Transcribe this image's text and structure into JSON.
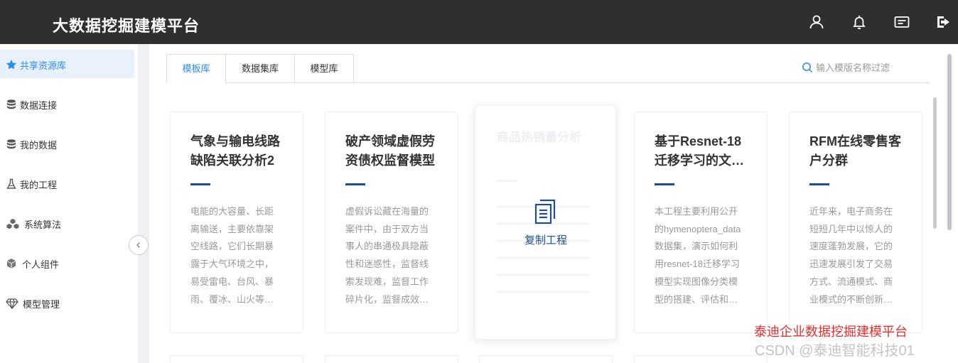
{
  "app": {
    "title": "大数据挖掘建模平台"
  },
  "header_icons": [
    "user-icon",
    "bell-icon",
    "message-icon",
    "logout-icon"
  ],
  "sidebar": {
    "items": [
      {
        "label": "共享资源库",
        "icon": "star-icon",
        "active": true
      },
      {
        "label": "数据连接",
        "icon": "database-icon"
      },
      {
        "label": "我的数据",
        "icon": "database-icon"
      },
      {
        "label": "我的工程",
        "icon": "flask-icon"
      },
      {
        "label": "系统算法",
        "icon": "cubes-icon"
      },
      {
        "label": "个人组件",
        "icon": "cube-icon"
      },
      {
        "label": "模型管理",
        "icon": "diamond-icon"
      }
    ]
  },
  "tabs": [
    {
      "label": "模板库",
      "active": true
    },
    {
      "label": "数据集库"
    },
    {
      "label": "模型库"
    }
  ],
  "search": {
    "placeholder": "输入模版名称过滤",
    "value": ""
  },
  "cards": [
    {
      "title_lines": [
        "气象与输电线路",
        "缺陷关联分析2"
      ],
      "desc_lines": [
        "电能的大容量、长距",
        "离输送，主要依靠架",
        "空线路，它们长期暴",
        "露于大气环境之中，",
        "易受雷电、台风、暴",
        "雨、覆冰、山火等…"
      ]
    },
    {
      "title_lines": [
        "破产领域虚假劳",
        "资债权监督模型"
      ],
      "desc_lines": [
        "虚假诉讼藏在海量的",
        "案件中，由于双方当",
        "事人的串通极具隐蔽",
        "性和迷惑性，监督线",
        "索发现难，监督工作",
        "碎片化，监督成效…"
      ]
    },
    {
      "title_lines": [
        "商品热销量分析"
      ],
      "desc_lines": [],
      "hover": true,
      "action_label": "复制工程"
    },
    {
      "title_lines": [
        "基于Resnet-18",
        "迁移学习的文…"
      ],
      "desc_lines": [
        "本工程主要利用公开",
        "的hymenoptera_data",
        "数据集，演示如何利",
        "用resnet-18迁移学习",
        "模型实现图像分类模",
        "型的搭建、评估和…"
      ]
    },
    {
      "title_lines": [
        "RFM在线零售客",
        "户分群"
      ],
      "desc_lines": [
        "近年来，电子商务在",
        "短短几年中以惊人的",
        "速度蓬勃发展，它的",
        "迅速发展引发了交易",
        "方式、流通模式、商",
        "业模式的不断创新…"
      ]
    }
  ],
  "watermark": {
    "line1": "泰迪企业数据挖掘建模平台",
    "line2": "CSDN @泰迪智能科技01"
  }
}
